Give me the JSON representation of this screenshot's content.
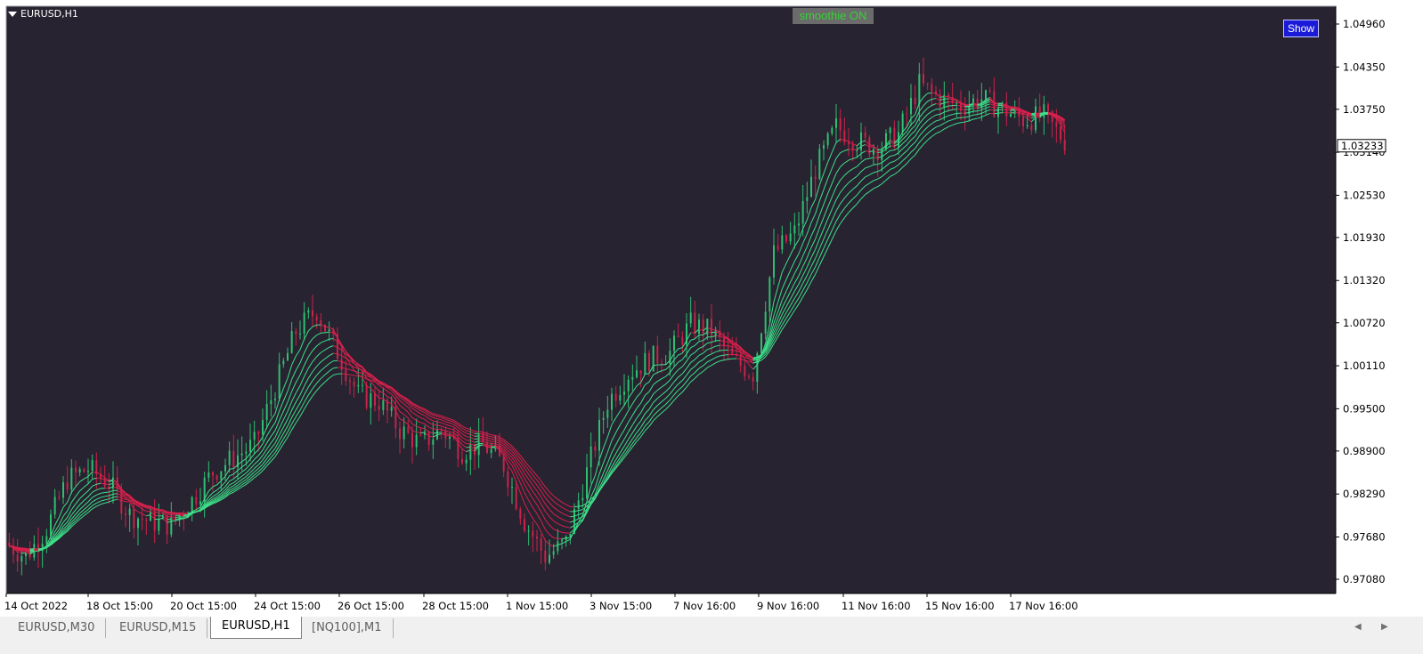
{
  "window": {
    "symbol_label": "EURUSD,H1"
  },
  "indicator": {
    "status_label": "smoothie ON",
    "show_button": "Show"
  },
  "colors": {
    "background": "#272330",
    "bull": "#2fbf71",
    "bear": "#c8234a",
    "ribbon_up": "#3ee08a",
    "ribbon_down": "#d8204c"
  },
  "chart_data": {
    "type": "candlestick",
    "title": "EURUSD,H1",
    "current_price": "1.03233",
    "price_ticks": [
      "1.04960",
      "1.04350",
      "1.03750",
      "1.03140",
      "1.02530",
      "1.01930",
      "1.01320",
      "1.00720",
      "1.00110",
      "0.99500",
      "0.98900",
      "0.98290",
      "0.97680",
      "0.97080"
    ],
    "ylim": [
      0.9682,
      1.0517
    ],
    "date_ticks": [
      "14 Oct 2022",
      "18 Oct 15:00",
      "20 Oct 15:00",
      "24 Oct 15:00",
      "26 Oct 15:00",
      "28 Oct 15:00",
      "1 Nov 15:00",
      "3 Nov 15:00",
      "7 Nov 16:00",
      "9 Nov 16:00",
      "11 Nov 16:00",
      "15 Nov 16:00",
      "17 Nov 16:00"
    ],
    "price_path": [
      {
        "t": 0,
        "p": 0.976
      },
      {
        "t": 5,
        "p": 0.974
      },
      {
        "t": 10,
        "p": 0.978
      },
      {
        "t": 15,
        "p": 0.985
      },
      {
        "t": 20,
        "p": 0.9865
      },
      {
        "t": 25,
        "p": 0.9845
      },
      {
        "t": 30,
        "p": 0.98
      },
      {
        "t": 35,
        "p": 0.979
      },
      {
        "t": 40,
        "p": 0.9785
      },
      {
        "t": 45,
        "p": 0.982
      },
      {
        "t": 50,
        "p": 0.986
      },
      {
        "t": 55,
        "p": 0.988
      },
      {
        "t": 60,
        "p": 0.99
      },
      {
        "t": 65,
        "p": 0.998
      },
      {
        "t": 70,
        "p": 1.006
      },
      {
        "t": 75,
        "p": 1.009
      },
      {
        "t": 80,
        "p": 1.003
      },
      {
        "t": 85,
        "p": 0.997
      },
      {
        "t": 90,
        "p": 0.996
      },
      {
        "t": 95,
        "p": 0.992
      },
      {
        "t": 100,
        "p": 0.99
      },
      {
        "t": 105,
        "p": 0.992
      },
      {
        "t": 110,
        "p": 0.989
      },
      {
        "t": 115,
        "p": 0.99
      },
      {
        "t": 120,
        "p": 0.987
      },
      {
        "t": 125,
        "p": 0.979
      },
      {
        "t": 130,
        "p": 0.974
      },
      {
        "t": 135,
        "p": 0.976
      },
      {
        "t": 140,
        "p": 0.986
      },
      {
        "t": 145,
        "p": 0.996
      },
      {
        "t": 150,
        "p": 1.0
      },
      {
        "t": 155,
        "p": 1.002
      },
      {
        "t": 160,
        "p": 1.003
      },
      {
        "t": 165,
        "p": 1.007
      },
      {
        "t": 170,
        "p": 1.006
      },
      {
        "t": 175,
        "p": 1.002
      },
      {
        "t": 180,
        "p": 1.0
      },
      {
        "t": 185,
        "p": 1.017
      },
      {
        "t": 190,
        "p": 1.02
      },
      {
        "t": 195,
        "p": 1.029
      },
      {
        "t": 200,
        "p": 1.035
      },
      {
        "t": 205,
        "p": 1.033
      },
      {
        "t": 210,
        "p": 1.032
      },
      {
        "t": 215,
        "p": 1.034
      },
      {
        "t": 220,
        "p": 1.041
      },
      {
        "t": 225,
        "p": 1.039
      },
      {
        "t": 230,
        "p": 1.038
      },
      {
        "t": 235,
        "p": 1.039
      },
      {
        "t": 240,
        "p": 1.0375
      },
      {
        "t": 245,
        "p": 1.036
      },
      {
        "t": 250,
        "p": 1.0365
      },
      {
        "t": 255,
        "p": 1.033
      }
    ],
    "ribbon_lines": 8,
    "legend": ""
  },
  "tabs": [
    {
      "label": "EURUSD,M30",
      "active": false
    },
    {
      "label": "EURUSD,M15",
      "active": false
    },
    {
      "label": "EURUSD,H1",
      "active": true
    },
    {
      "label": "[NQ100],M1",
      "active": false
    }
  ]
}
